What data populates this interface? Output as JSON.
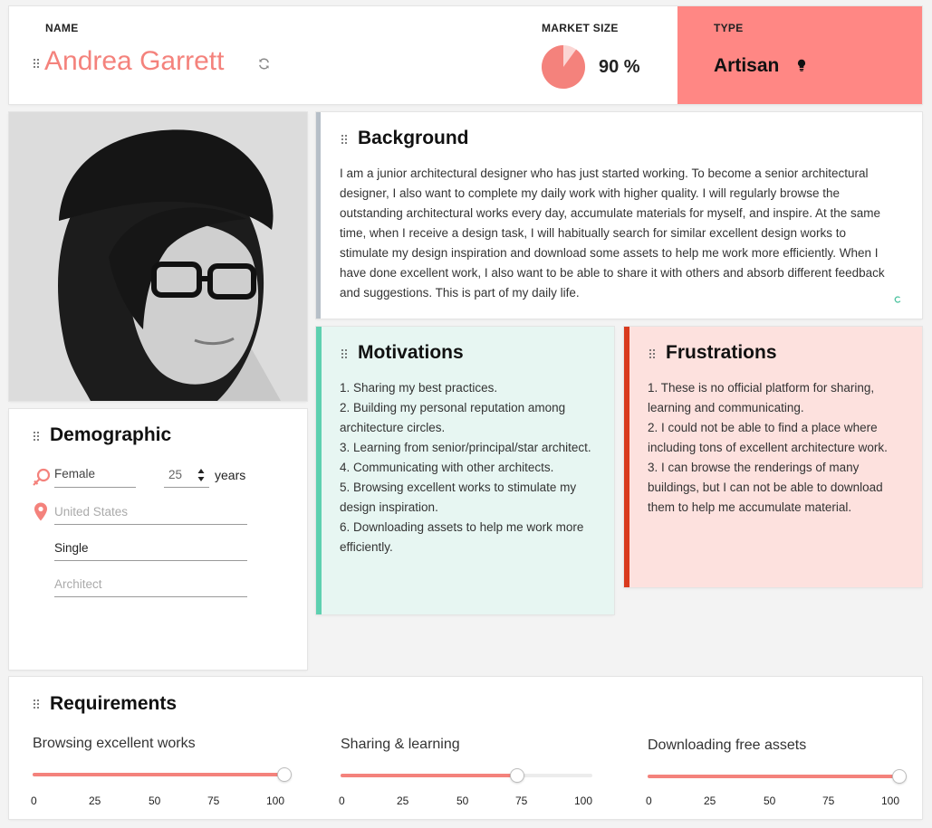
{
  "header": {
    "name_label": "NAME",
    "name": "Andrea Garrett",
    "market_label": "MARKET SIZE",
    "market_value": "90 %",
    "market_fraction": 0.9,
    "type_label": "TYPE",
    "type_value": "Artisan"
  },
  "colors": {
    "accent": "#f4827c",
    "type_bg": "#ff8784",
    "motivation_bar": "#5ed0b0",
    "motivation_bg": "#e7f6f2",
    "frustration_bar": "#d93a1e",
    "frustration_bg": "#fde1de",
    "background_bar": "#b6bfc8"
  },
  "background": {
    "title": "Background",
    "text": "I am a junior architectural designer who has just started working. To become a senior architectural designer, I also want to complete my daily work with higher quality. I will regularly browse the outstanding architectural works every day, accumulate materials for myself, and inspire. At the same time, when I receive a design task, I will habitually search for similar excellent design works to stimulate my design inspiration and download some assets to help me work more efficiently. When I have done excellent work, I also want to be able to share it with others and absorb different feedback and suggestions. This is part of my daily life."
  },
  "motivations": {
    "title": "Motivations",
    "text": "1. Sharing my best practices.\n2. Building my personal reputation among architecture circles.\n3. Learning from senior/principal/star architect.\n4. Communicating with other architects.\n5. Browsing excellent works to stimulate my design inspiration.\n6. Downloading assets to help me work more efficiently."
  },
  "frustrations": {
    "title": "Frustrations",
    "text": "1. These is no official platform for sharing, learning and communicating.\n2. I could not be able to find a place where including tons of excellent architecture work.\n3. I can browse the renderings of many buildings, but I can not be able to download them to help me accumulate material."
  },
  "demographic": {
    "title": "Demographic",
    "gender": "Female",
    "age": "25",
    "age_unit": "years",
    "location_placeholder": "United States",
    "status": "Single",
    "occupation_placeholder": "Architect"
  },
  "requirements": {
    "title": "Requirements",
    "sliders": [
      {
        "label": "Browsing excellent works",
        "value": 100
      },
      {
        "label": "Sharing & learning",
        "value": 70
      },
      {
        "label": "Downloading free assets",
        "value": 100
      }
    ],
    "ticks": [
      "0",
      "25",
      "50",
      "75",
      "100"
    ]
  }
}
